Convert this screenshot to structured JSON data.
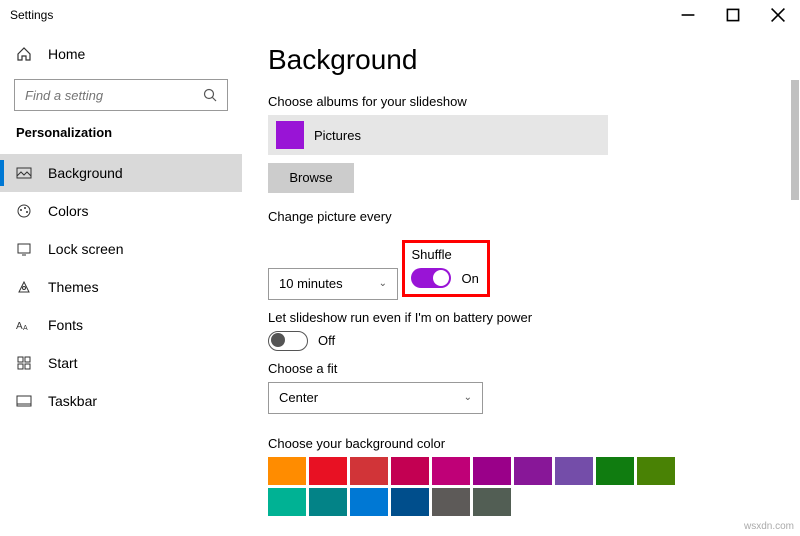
{
  "window": {
    "title": "Settings"
  },
  "sidebar": {
    "home": "Home",
    "search_placeholder": "Find a setting",
    "section": "Personalization",
    "items": [
      {
        "label": "Background"
      },
      {
        "label": "Colors"
      },
      {
        "label": "Lock screen"
      },
      {
        "label": "Themes"
      },
      {
        "label": "Fonts"
      },
      {
        "label": "Start"
      },
      {
        "label": "Taskbar"
      }
    ]
  },
  "main": {
    "title": "Background",
    "choose_albums": "Choose albums for your slideshow",
    "album_name": "Pictures",
    "browse": "Browse",
    "change_label": "Change picture every",
    "change_value": "10 minutes",
    "shuffle_label": "Shuffle",
    "shuffle_state": "On",
    "battery_label": "Let slideshow run even if I'm on battery power",
    "battery_state": "Off",
    "fit_label": "Choose a fit",
    "fit_value": "Center",
    "color_label": "Choose your background color",
    "colors": [
      "#ff8c00",
      "#e81123",
      "#d13438",
      "#c30052",
      "#bf0077",
      "#9a0089",
      "#881798",
      "#744da9",
      "#107c10",
      "#498205",
      "#00b294",
      "#038387",
      "#0078d4",
      "#004e8c",
      "#5d5a58",
      "#525e54"
    ]
  },
  "watermark": "wsxdn.com"
}
